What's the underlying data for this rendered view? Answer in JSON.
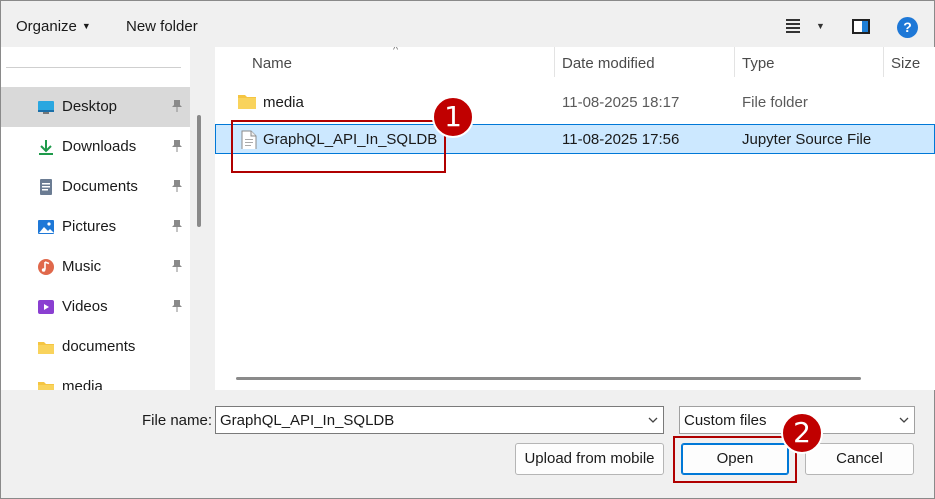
{
  "toolbar": {
    "organize_label": "Organize",
    "new_folder_label": "New folder",
    "help_glyph": "?"
  },
  "nav": {
    "items": [
      {
        "label": "Desktop",
        "icon": "desktop-icon",
        "pinned": true,
        "selected": true
      },
      {
        "label": "Downloads",
        "icon": "download-icon",
        "pinned": true
      },
      {
        "label": "Documents",
        "icon": "documents-icon",
        "pinned": true
      },
      {
        "label": "Pictures",
        "icon": "pictures-icon",
        "pinned": true
      },
      {
        "label": "Music",
        "icon": "music-icon",
        "pinned": true
      },
      {
        "label": "Videos",
        "icon": "videos-icon",
        "pinned": true
      },
      {
        "label": "documents",
        "icon": "folder-icon",
        "pinned": false
      },
      {
        "label": "media",
        "icon": "folder-icon",
        "pinned": false
      }
    ]
  },
  "list": {
    "columns": {
      "name": "Name",
      "date": "Date modified",
      "type": "Type",
      "size": "Size"
    },
    "rows": [
      {
        "name": "media",
        "date": "11-08-2025 18:17",
        "type": "File folder",
        "icon": "folder-icon"
      },
      {
        "name": "GraphQL_API_In_SQLDB",
        "date": "11-08-2025 17:56",
        "type": "Jupyter Source File",
        "icon": "file-icon",
        "selected": true
      }
    ]
  },
  "bottom": {
    "file_name_label": "File name:",
    "file_name_value": "GraphQL_API_In_SQLDB",
    "filter_value": "Custom files",
    "upload_label": "Upload from mobile",
    "open_label": "Open",
    "cancel_label": "Cancel"
  },
  "annotations": {
    "step1": "1",
    "step2": "2"
  },
  "colors": {
    "selection": "#cce8ff",
    "accent": "#0078d7",
    "annotation": "#c00000"
  }
}
